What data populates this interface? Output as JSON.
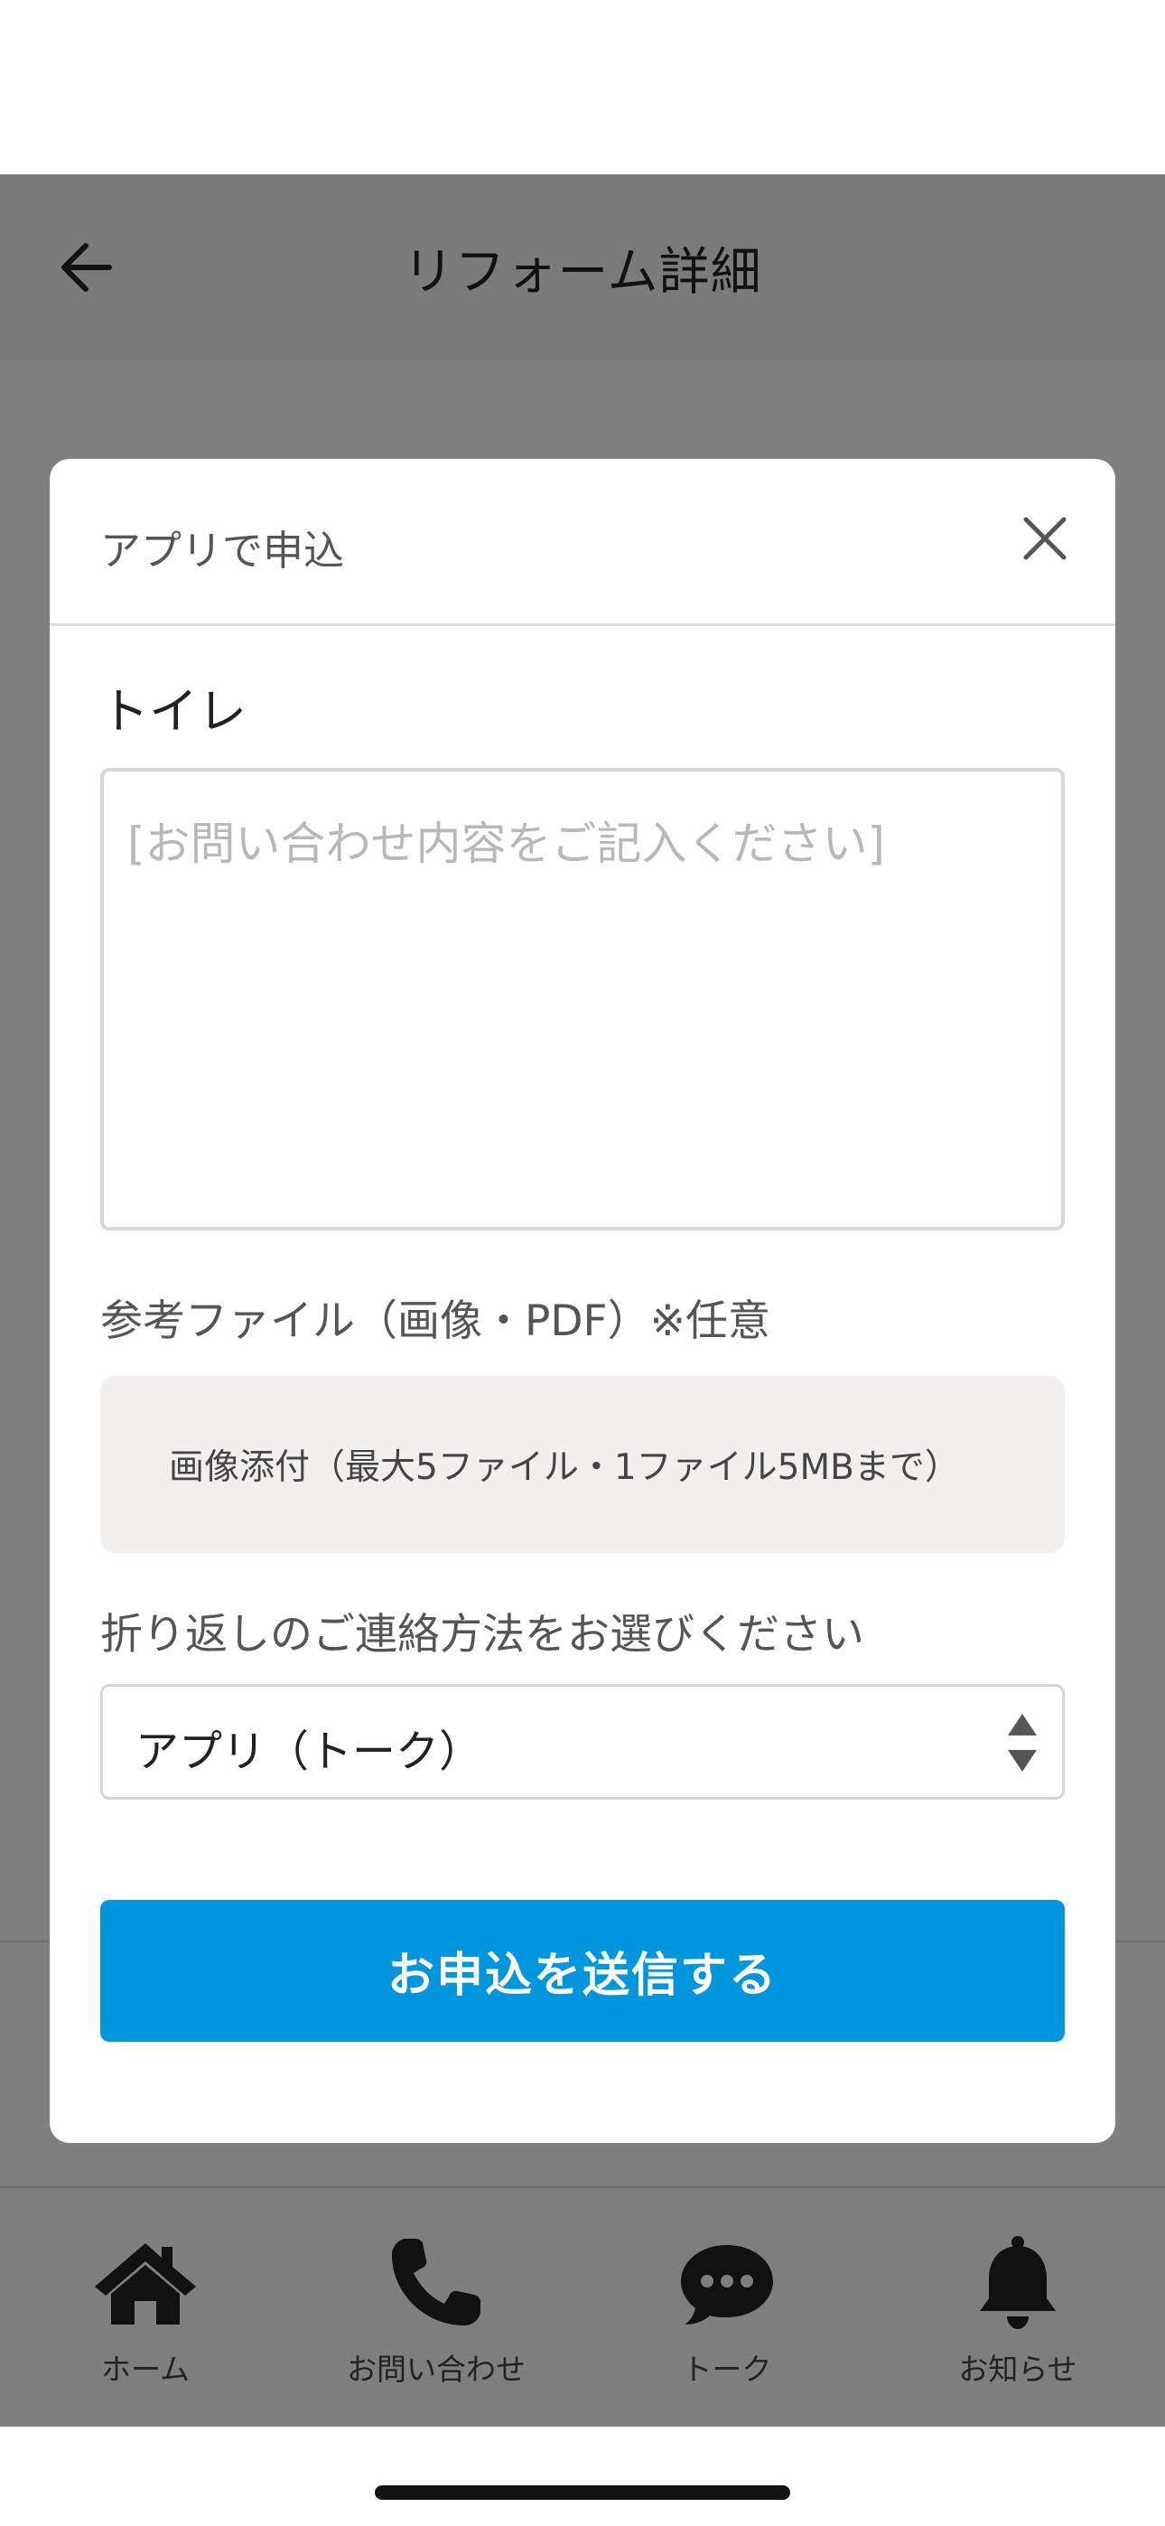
{
  "header": {
    "title": "リフォーム詳細",
    "back_icon": "arrow-left-icon"
  },
  "modal": {
    "title": "アプリで申込",
    "close_icon": "close-icon",
    "item_name": "トイレ",
    "inquiry": {
      "value": "",
      "placeholder": "[お問い合わせ内容をご記入ください]"
    },
    "file_label": "参考ファイル（画像・PDF）※任意",
    "file_button_label": "画像添付（最大5ファイル・1ファイル5MBまで）",
    "contact_label": "折り返しのご連絡方法をお選びください",
    "contact_select": {
      "selected": "アプリ（トーク）",
      "icon": "select-arrows-icon"
    },
    "submit_label": "お申込を送信する",
    "accent_color": "#0096dd"
  },
  "tabs": [
    {
      "label": "ホーム",
      "icon": "home-icon"
    },
    {
      "label": "お問い合わせ",
      "icon": "phone-icon"
    },
    {
      "label": "トーク",
      "icon": "chat-bubble-icon"
    },
    {
      "label": "お知らせ",
      "icon": "bell-icon"
    }
  ]
}
